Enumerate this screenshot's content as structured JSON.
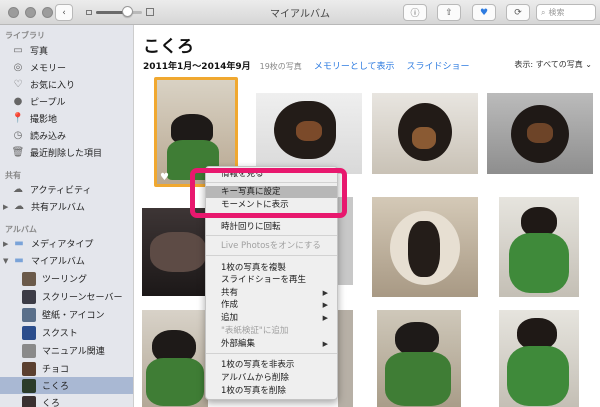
{
  "window": {
    "title": "マイアルバム"
  },
  "toolbar": {
    "search_placeholder": "検索"
  },
  "sidebar": {
    "library_header": "ライブラリ",
    "library": [
      {
        "label": "写真",
        "icon": "photos-icon"
      },
      {
        "label": "メモリー",
        "icon": "memories-icon"
      },
      {
        "label": "お気に入り",
        "icon": "favorites-icon"
      },
      {
        "label": "ピープル",
        "icon": "people-icon"
      },
      {
        "label": "撮影地",
        "icon": "places-icon"
      },
      {
        "label": "読み込み",
        "icon": "imports-icon"
      },
      {
        "label": "最近削除した項目",
        "icon": "trash-icon"
      }
    ],
    "shared_header": "共有",
    "shared": [
      {
        "label": "アクティビティ",
        "icon": "cloud-icon"
      },
      {
        "label": "共有アルバム",
        "icon": "shared-album-icon"
      }
    ],
    "albums_header": "アルバム",
    "albums": [
      {
        "label": "メディアタイプ"
      },
      {
        "label": "マイアルバム"
      }
    ],
    "my_albums": [
      {
        "label": "ツーリング"
      },
      {
        "label": "スクリーンセーバー"
      },
      {
        "label": "壁紙・アイコン"
      },
      {
        "label": "スクスト"
      },
      {
        "label": "マニュアル関連"
      },
      {
        "label": "チョコ"
      },
      {
        "label": "こくろ"
      },
      {
        "label": "くろ"
      }
    ],
    "selected": "こくろ"
  },
  "main": {
    "title": "こくろ",
    "date_range": "2011年1月〜2014年9月",
    "count": "19枚の写真",
    "show_as_memory": "メモリーとして表示",
    "slideshow": "スライドショー",
    "show_filter": "表示: すべての写真 ⌄"
  },
  "context_menu": {
    "items": [
      {
        "label": "情報を見る"
      },
      {
        "label": "キー写真に設定"
      },
      {
        "label": "モーメントに表示"
      },
      {
        "label": "時計回りに回転"
      },
      {
        "label": "Live Photosをオンにする"
      },
      {
        "label": "1枚の写真を複製"
      },
      {
        "label": "スライドショーを再生"
      },
      {
        "label": "共有"
      },
      {
        "label": "作成"
      },
      {
        "label": "追加"
      },
      {
        "label": "\"表紙検証\"に追加"
      },
      {
        "label": "外部編集"
      },
      {
        "label": "1枚の写真を非表示"
      },
      {
        "label": "アルバムから削除"
      },
      {
        "label": "1枚の写真を削除"
      }
    ]
  },
  "colors": {
    "accent": "#2d7be0",
    "highlight_border": "#e8186e",
    "selection": "#f0a830"
  }
}
